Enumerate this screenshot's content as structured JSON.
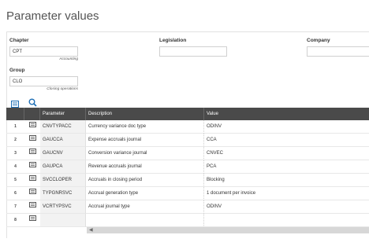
{
  "page": {
    "title": "Parameter values"
  },
  "fields": {
    "chapter": {
      "label": "Chapter",
      "value": "CPT",
      "description": "Accounting"
    },
    "legislation": {
      "label": "Legislation",
      "value": ""
    },
    "company": {
      "label": "Company",
      "value": ""
    },
    "group": {
      "label": "Group",
      "value": "CLO",
      "description": "Closing operations"
    }
  },
  "toolbar": {
    "icons": [
      "list-icon",
      "search-icon"
    ]
  },
  "table": {
    "headers": {
      "parameter": "Parameter",
      "description": "Description",
      "value": "Value"
    },
    "rows": [
      {
        "num": "1",
        "parameter": "CNVTYPACC",
        "description": "Currency variance doc type",
        "value": "ODINV"
      },
      {
        "num": "2",
        "parameter": "GAUCCA",
        "description": "Expense accruals journal",
        "value": "CCA"
      },
      {
        "num": "3",
        "parameter": "GAUCNV",
        "description": "Conversion variance journal",
        "value": "CNVEC"
      },
      {
        "num": "4",
        "parameter": "GAUPCA",
        "description": "Revenue accruals journal",
        "value": "PCA"
      },
      {
        "num": "5",
        "parameter": "SVCCLOPER",
        "description": "Accruals in closing period",
        "value": "Blocking"
      },
      {
        "num": "6",
        "parameter": "TYPGNRSVC",
        "description": "Accrual generation type",
        "value": "1 document per invoice"
      },
      {
        "num": "7",
        "parameter": "VCRTYPSVC",
        "description": "Accrual journal type",
        "value": "ODINV"
      },
      {
        "num": "8",
        "parameter": "",
        "description": "",
        "value": ""
      }
    ]
  },
  "colors": {
    "header_bg": "#4a4a4a",
    "accent": "#1e6fb6"
  }
}
